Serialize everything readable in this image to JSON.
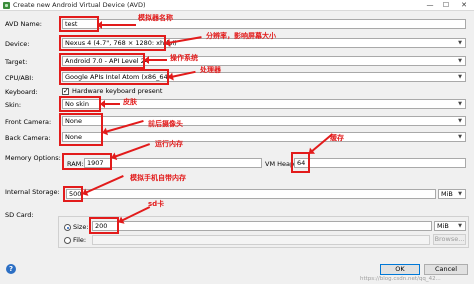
{
  "window": {
    "title": "Create new Android Virtual Device (AVD)",
    "minimize": "—",
    "maximize": "☐",
    "close": "✕"
  },
  "form": {
    "avd_name": {
      "label": "AVD Name:",
      "value": "test"
    },
    "device": {
      "label": "Device:",
      "value": "Nexus 4 (4.7\", 768 × 1280: xhdpi)"
    },
    "target": {
      "label": "Target:",
      "value": "Android 7.0 - API Level 24"
    },
    "cpu_abi": {
      "label": "CPU/ABI:",
      "value": "Google APIs Intel Atom (x86_64)"
    },
    "keyboard": {
      "label": "Keyboard:",
      "checkbox_label": "Hardware keyboard present",
      "checked": true
    },
    "skin": {
      "label": "Skin:",
      "value": "No skin"
    },
    "front_camera": {
      "label": "Front Camera:",
      "value": "None"
    },
    "back_camera": {
      "label": "Back Camera:",
      "value": "None"
    },
    "memory": {
      "label": "Memory Options:",
      "ram_label": "RAM:",
      "ram_value": "1907",
      "vm_heap_label": "VM Heap:",
      "vm_heap_value": "64"
    },
    "internal_storage": {
      "label": "Internal Storage:",
      "value": "500",
      "unit": "MiB"
    },
    "sd_card": {
      "label": "SD Card:",
      "size_label": "Size:",
      "size_value": "200",
      "size_unit": "MiB",
      "file_label": "File:",
      "browse_label": "Browse..."
    }
  },
  "annotations": {
    "avd_name": "模拟器名称",
    "device": "分辨率，影响屏幕大小",
    "target": "操作系统",
    "cpu_abi": "处理器",
    "skin": "皮肤",
    "cameras": "前后摄像头",
    "ram": "运行内存",
    "vm_heap": "缓存",
    "internal_storage": "模拟手机自带内存",
    "sd_card": "sd卡"
  },
  "buttons": {
    "ok": "OK",
    "cancel": "Cancel"
  },
  "watermark": "https://blog.csdn.net/qq_42...",
  "colors": {
    "annotation_red": "#e21b1b",
    "focus_blue": "#0078d7"
  }
}
